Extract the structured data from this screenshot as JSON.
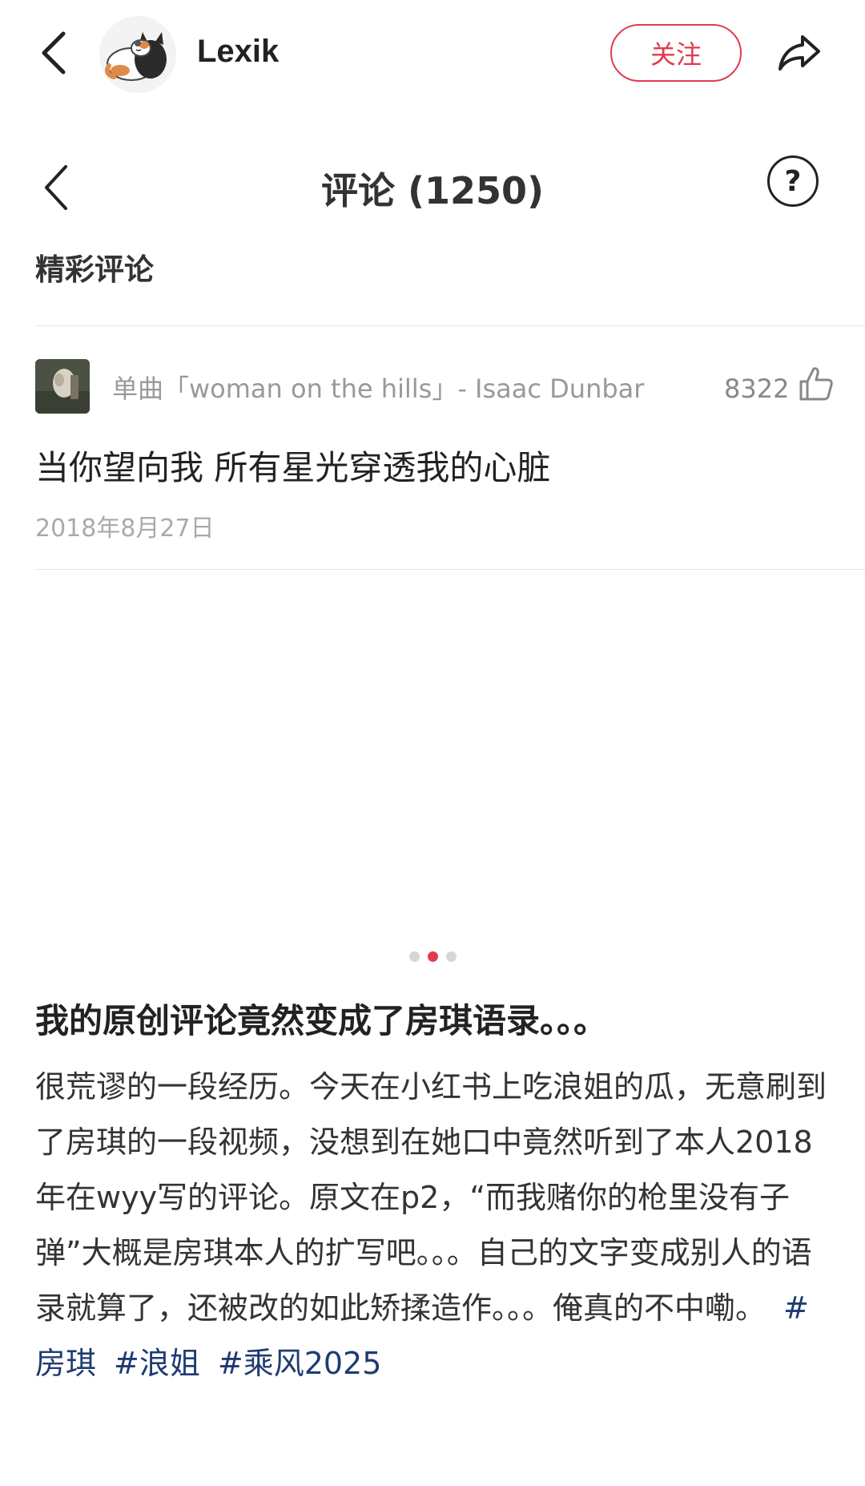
{
  "header": {
    "username": "Lexik",
    "follow_label": "关注",
    "accent": "#e23b4e"
  },
  "screenshot": {
    "title": "评论 (1250)",
    "section": "精彩评论",
    "comment": {
      "song": "单曲「woman on the hills」- Isaac Dunbar",
      "likes": "8322",
      "text": "当你望向我 所有星光穿透我的心脏",
      "date": "2018年8月27日"
    }
  },
  "pagination": {
    "total": 3,
    "active": 2
  },
  "post": {
    "title": "我的原创评论竟然变成了房琪语录。。。",
    "body": "很荒谬的一段经历。今天在小红书上吃浪姐的瓜，无意刷到了房琪的一段视频，没想到在她口中竟然听到了本人2018年在wyy写的评论。原文在p2，“而我赌你的枪里没有子弹”大概是房琪本人的扩写吧。。。自己的文字变成别人的语录就算了，还被改的如此矫揉造作。。。俺真的不中嘞。",
    "tags": [
      "#房琪",
      "#浪姐",
      "#乘风2025"
    ],
    "tag_color": "#1f3b72"
  }
}
